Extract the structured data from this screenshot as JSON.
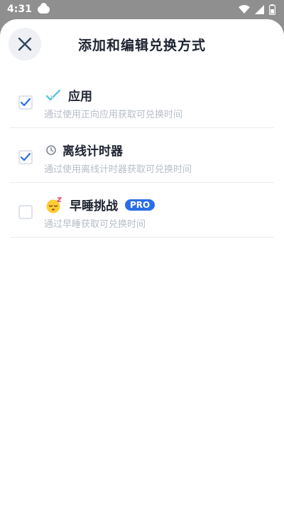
{
  "status_bar": {
    "time": "4:31",
    "icons": [
      "cloud-icon",
      "wifi-icon",
      "signal-icon",
      "battery-icon"
    ]
  },
  "header": {
    "title": "添加和编辑兑换方式",
    "close_icon": "close-icon"
  },
  "options": [
    {
      "title": "应用",
      "description": "通过使用正向应用获取可兑换时间",
      "checked": true,
      "icon": "double-check-icon"
    },
    {
      "title": "离线计时器",
      "description": "通过使用离线计时器获取可兑换时间",
      "checked": true,
      "icon": "timer-icon"
    },
    {
      "title": "早睡挑战",
      "description": "通过早睡获取可兑换时间",
      "checked": false,
      "icon": "sleeping-face-icon",
      "badge": "PRO"
    }
  ],
  "colors": {
    "accent": "#2b6fe6",
    "title_text": "#1d2330",
    "secondary_text": "#b7bdc8"
  }
}
